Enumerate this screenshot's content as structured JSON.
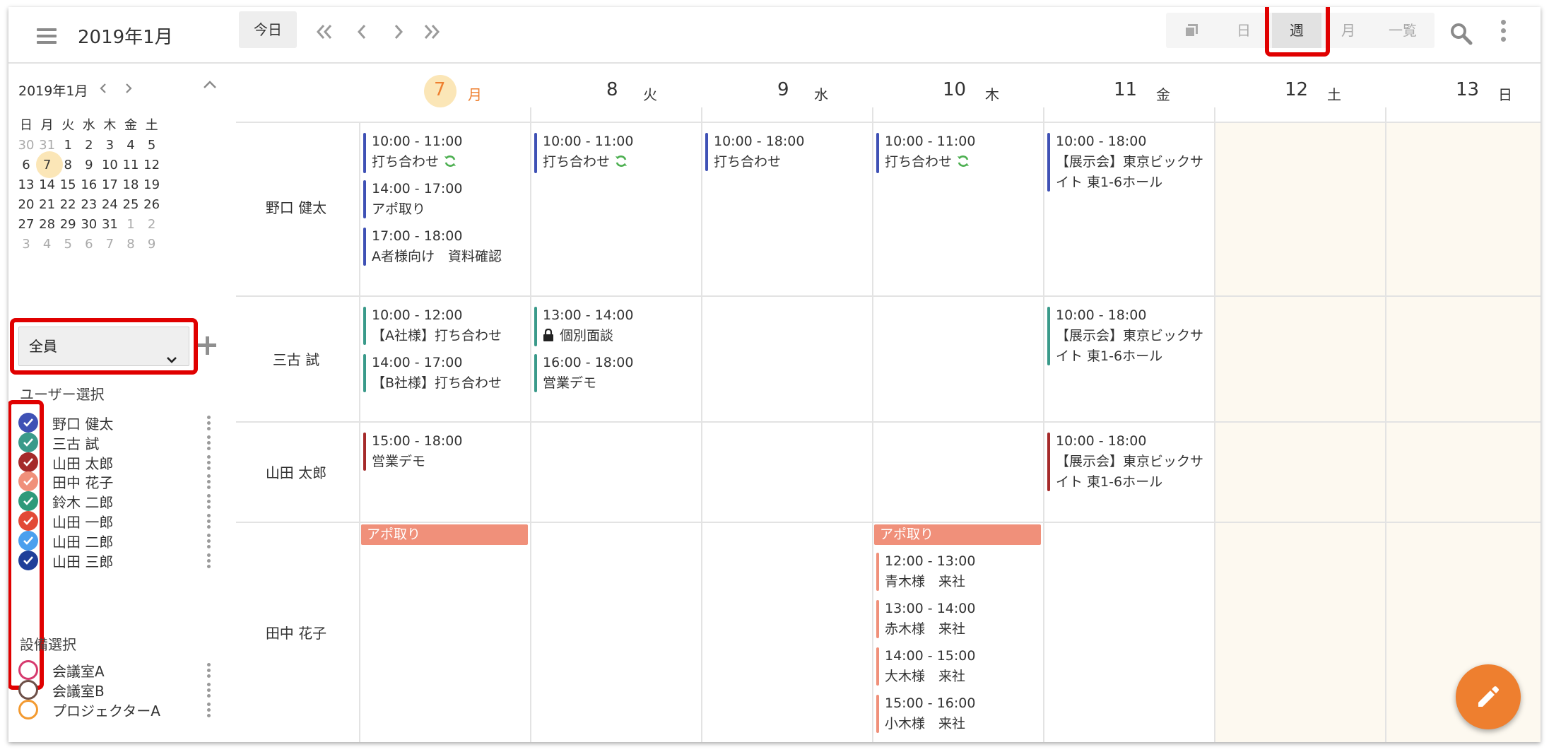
{
  "header": {
    "title": "2019年1月",
    "today": "今日",
    "views": [
      "日",
      "週",
      "月",
      "一覧"
    ]
  },
  "mini_calendar": {
    "title": "2019年1月",
    "weekdays": [
      "日",
      "月",
      "火",
      "水",
      "木",
      "金",
      "土"
    ],
    "weeks": [
      [
        "30",
        "31",
        "1",
        "2",
        "3",
        "4",
        "5"
      ],
      [
        "6",
        "7",
        "8",
        "9",
        "10",
        "11",
        "12"
      ],
      [
        "13",
        "14",
        "15",
        "16",
        "17",
        "18",
        "19"
      ],
      [
        "20",
        "21",
        "22",
        "23",
        "24",
        "25",
        "26"
      ],
      [
        "27",
        "28",
        "29",
        "30",
        "31",
        "1",
        "2"
      ],
      [
        "3",
        "4",
        "5",
        "6",
        "7",
        "8",
        "9"
      ]
    ],
    "today": "7"
  },
  "filter": {
    "selected": "全員"
  },
  "users_label": "ユーザー選択",
  "users": [
    {
      "name": "野口 健太",
      "color": "#3f51b5"
    },
    {
      "name": "三古 試",
      "color": "#3a9a8a"
    },
    {
      "name": "山田 太郎",
      "color": "#a52a2a"
    },
    {
      "name": "田中 花子",
      "color": "#f0907a"
    },
    {
      "name": "鈴木 二郎",
      "color": "#2e9a7a"
    },
    {
      "name": "山田 一郎",
      "color": "#e24a36"
    },
    {
      "name": "山田 二郎",
      "color": "#4aa0ee"
    },
    {
      "name": "山田 三郎",
      "color": "#1f3f99"
    }
  ],
  "facilities_label": "設備選択",
  "facilities": [
    {
      "name": "会議室A",
      "color": "#d63a6e"
    },
    {
      "name": "会議室B",
      "color": "#6d5048"
    },
    {
      "name": "プロジェクターA",
      "color": "#f39a30"
    }
  ],
  "week": {
    "days": [
      {
        "num": "7",
        "wd": "月"
      },
      {
        "num": "8",
        "wd": "火"
      },
      {
        "num": "9",
        "wd": "水"
      },
      {
        "num": "10",
        "wd": "木"
      },
      {
        "num": "11",
        "wd": "金"
      },
      {
        "num": "12",
        "wd": "土"
      },
      {
        "num": "13",
        "wd": "日"
      }
    ],
    "rows": [
      {
        "person": "野口 健太",
        "events": [
          {
            "day": 0,
            "slot": 0,
            "time": "10:00 - 11:00",
            "title": "打ち合わせ",
            "sync": true
          },
          {
            "day": 0,
            "slot": 1,
            "time": "14:00 - 17:00",
            "title": "アポ取り"
          },
          {
            "day": 0,
            "slot": 2,
            "time": "17:00 - 18:00",
            "title": "A者様向け　資料確認"
          },
          {
            "day": 1,
            "slot": 0,
            "time": "10:00 - 11:00",
            "title": "打ち合わせ",
            "sync": true
          },
          {
            "day": 2,
            "slot": 0,
            "time": "10:00 - 18:00",
            "title": "打ち合わせ"
          },
          {
            "day": 3,
            "slot": 0,
            "time": "10:00 - 11:00",
            "title": "打ち合わせ",
            "sync": true
          },
          {
            "day": 4,
            "slot": 0,
            "time": "10:00 - 18:00",
            "title": "【展示会】東京ビックサ",
            "title2": "イト 東1-6ホール"
          }
        ]
      },
      {
        "person": "三古 試",
        "events": [
          {
            "day": 0,
            "slot": 0,
            "time": "10:00 - 12:00",
            "title": "【A社様】打ち合わせ"
          },
          {
            "day": 0,
            "slot": 1,
            "time": "14:00 - 17:00",
            "title": "【B社様】打ち合わせ"
          },
          {
            "day": 1,
            "slot": 0,
            "time": "13:00 - 14:00",
            "title": "個別面談",
            "lock": true
          },
          {
            "day": 1,
            "slot": 1,
            "time": "16:00 - 18:00",
            "title": "営業デモ"
          },
          {
            "day": 4,
            "slot": 0,
            "time": "10:00 - 18:00",
            "title": "【展示会】東京ビックサ",
            "title2": "イト 東1-6ホール"
          }
        ]
      },
      {
        "person": "山田 太郎",
        "events": [
          {
            "day": 0,
            "slot": 0,
            "time": "15:00 - 18:00",
            "title": "営業デモ"
          },
          {
            "day": 4,
            "slot": 0,
            "time": "10:00 - 18:00",
            "title": "【展示会】東京ビックサ",
            "title2": "イト 東1-6ホール"
          }
        ]
      },
      {
        "person": "田中 花子",
        "allday": [
          {
            "day": 0,
            "title": "アポ取り"
          },
          {
            "day": 3,
            "title": "アポ取り"
          }
        ],
        "events": [
          {
            "day": 3,
            "slot": 0,
            "time": "12:00 - 13:00",
            "title": "青木様　来社"
          },
          {
            "day": 3,
            "slot": 1,
            "time": "13:00 - 14:00",
            "title": "赤木様　来社"
          },
          {
            "day": 3,
            "slot": 2,
            "time": "14:00 - 15:00",
            "title": "大木様　来社"
          },
          {
            "day": 3,
            "slot": 3,
            "time": "15:00 - 16:00",
            "title": "小木様　来社"
          }
        ]
      }
    ]
  }
}
